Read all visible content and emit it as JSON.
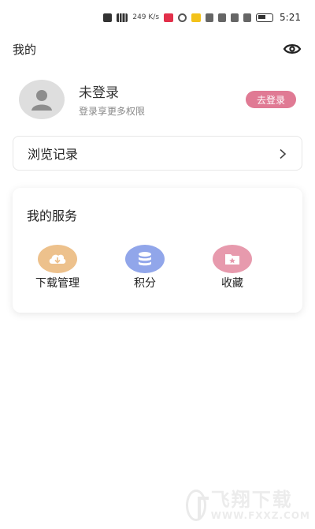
{
  "status_bar": {
    "speed_value": "249",
    "speed_unit": "K/s",
    "time": "5:21"
  },
  "header": {
    "title": "我的",
    "settings_icon": "eye-icon"
  },
  "profile": {
    "name": "未登录",
    "subtitle": "登录享更多权限",
    "login_button": "去登录",
    "accent_color": "#e07a94"
  },
  "history": {
    "label": "浏览记录"
  },
  "services": {
    "title": "我的服务",
    "items": [
      {
        "label": "下载管理",
        "icon": "cloud-download-icon",
        "color": "#edc18c"
      },
      {
        "label": "积分",
        "icon": "coin-stack-icon",
        "color": "#91a6ea"
      },
      {
        "label": "收藏",
        "icon": "star-folder-icon",
        "color": "#e79aad"
      }
    ]
  },
  "watermark": {
    "brand_cn": "飞翔下载",
    "brand_en": "WWW.FXXZ.COM"
  }
}
